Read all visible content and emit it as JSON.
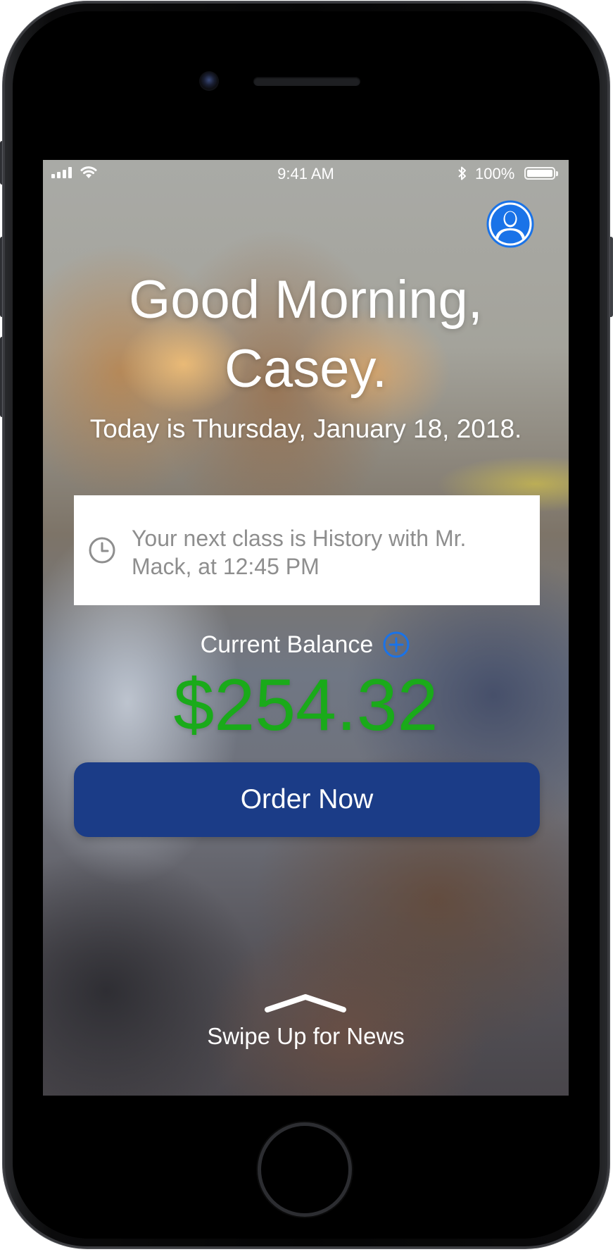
{
  "status_bar": {
    "time": "9:41 AM",
    "battery_percent": "100%",
    "signal_bars": 4,
    "battery_level": 1.0
  },
  "greeting": {
    "line1": "Good Morning,",
    "line2": "Casey."
  },
  "date_line": "Today is Thursday, January 18, 2018.",
  "next_class": {
    "text": "Your next class is History with Mr. Mack, at 12:45 PM"
  },
  "balance": {
    "label": "Current Balance",
    "amount": "$254.32"
  },
  "order_button": {
    "label": "Order Now"
  },
  "swipe": {
    "label": "Swipe Up for News"
  },
  "colors": {
    "accent_blue": "#1a73e8",
    "button_blue": "#1b3c87",
    "balance_green": "#1aaa1a"
  },
  "icons": {
    "avatar": "user-avatar-icon",
    "clock": "clock-icon",
    "add": "plus-circle-icon",
    "chevron": "chevron-up-icon",
    "wifi": "wifi-icon",
    "bluetooth": "bluetooth-icon",
    "battery": "battery-icon",
    "signal": "signal-icon"
  }
}
